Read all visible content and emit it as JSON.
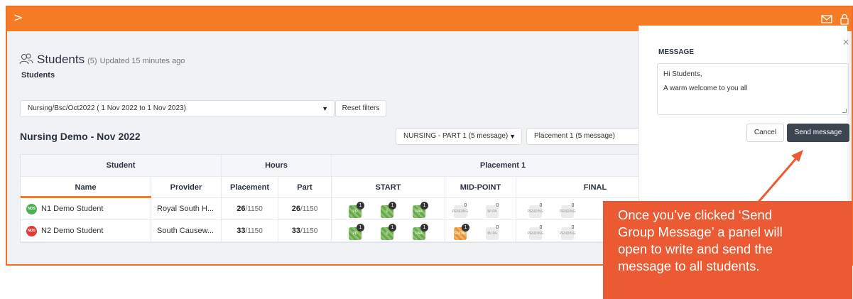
{
  "topbar": {
    "toggle_glyph": ">",
    "bg": "#f57c25"
  },
  "header": {
    "title": "Students",
    "count": "(5)",
    "updated": "Updated 15 minutes ago",
    "subtitle": "Students"
  },
  "filters": {
    "cohort": "Nursing/Bsc/Oct2022 ( 1 Nov 2022 to 1 Nov 2023)",
    "reset_label": "Reset filters",
    "part": "NURSING - PART 1 (5 message)",
    "placement": "Placement 1 (5 message)"
  },
  "section_title": "Nursing Demo - Nov 2022",
  "table": {
    "group_headers": {
      "student": "Student",
      "hours": "Hours",
      "placement": "Placement 1"
    },
    "columns": {
      "name": "Name",
      "provider": "Provider",
      "placement": "Placement",
      "part": "Part",
      "start": "START",
      "mid": "MID-POINT",
      "final": "FINAL"
    },
    "rows": [
      {
        "initials": "NDS",
        "avatar_color": "#4caf50",
        "name": "N1 Demo Student",
        "provider": "Royal South H...",
        "placement_hours": "26",
        "placement_total": "/1150",
        "part_hours": "26",
        "part_total": "/1150",
        "start_badges": [
          {
            "label": "PD",
            "count": "1"
          },
          {
            "label": "0",
            "count": "1"
          },
          {
            "label": "PAA",
            "count": "1"
          }
        ],
        "mid_badges": [
          {
            "label": "PENDING",
            "count": "0"
          },
          {
            "label": "MI PA",
            "count": "0"
          }
        ],
        "final_badges": [
          {
            "label": "PENDING",
            "count": "0"
          },
          {
            "label": "PENDING",
            "count": "0"
          }
        ]
      },
      {
        "initials": "NDS",
        "avatar_color": "#e53935",
        "name": "N2 Demo Student",
        "provider": "South Causew...",
        "placement_hours": "33",
        "placement_total": "/1150",
        "part_hours": "33",
        "part_total": "/1150",
        "start_badges": [
          {
            "label": "PD",
            "count": "1"
          },
          {
            "label": "0",
            "count": "1"
          },
          {
            "label": "PAA",
            "count": "1"
          }
        ],
        "mid_badges": [
          {
            "label": "PENDING",
            "count": "1"
          },
          {
            "label": "MI PA",
            "count": "0"
          }
        ],
        "final_badges": [
          {
            "label": "PENDING",
            "count": "0"
          },
          {
            "label": "PENDING",
            "count": "0"
          }
        ]
      }
    ]
  },
  "panel": {
    "close_glyph": "×",
    "label": "MESSAGE",
    "message_line1": "Hi Students,",
    "message_line2": "A warm welcome to you all",
    "cancel_label": "Cancel",
    "send_label": "Send message"
  },
  "callout": {
    "line1": "Once you’ve clicked ‘Send",
    "line2": "Group Message’ a panel will",
    "line3": "open to write and send the",
    "line4": "message to all students.",
    "bg": "#ec5a33"
  }
}
